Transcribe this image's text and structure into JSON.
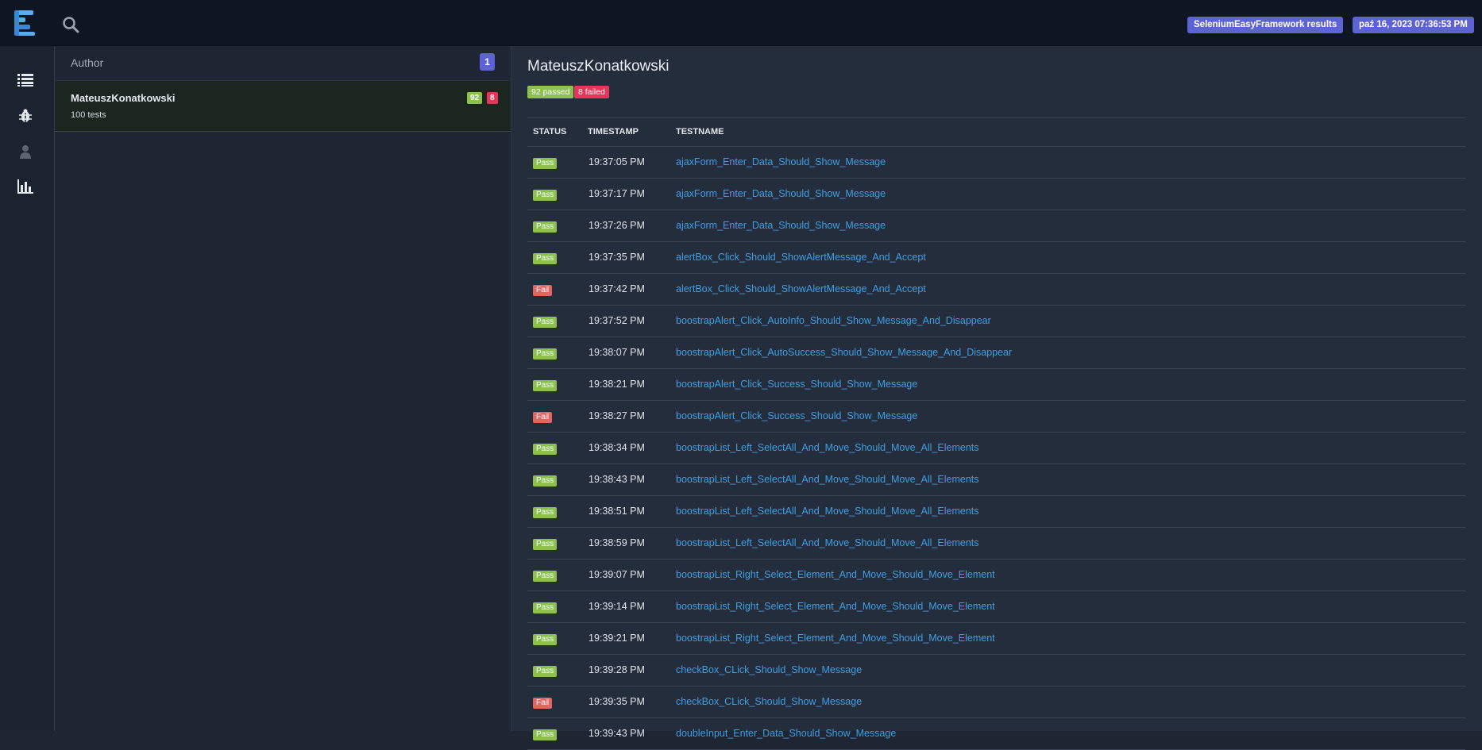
{
  "header": {
    "project_badge": "SeleniumEasyFramework results",
    "date_badge": "paź 16, 2023 07:36:53 PM",
    "logo_icon": "extent-logo-icon",
    "search_icon": "search-icon"
  },
  "nav": {
    "items": [
      {
        "icon": "list-icon"
      },
      {
        "icon": "bug-icon"
      },
      {
        "icon": "user-icon"
      },
      {
        "icon": "bar-chart-icon"
      }
    ]
  },
  "category": {
    "title": "Author",
    "count": "1",
    "items": [
      {
        "name": "MateuszKonatkowski",
        "sub": "100 tests",
        "passed": "92",
        "failed": "8"
      }
    ]
  },
  "detail": {
    "title": "MateuszKonatkowski",
    "passed_label": "92 passed",
    "failed_label": "8 failed",
    "columns": {
      "status": "STATUS",
      "timestamp": "TIMESTAMP",
      "testname": "TESTNAME"
    },
    "rows": [
      {
        "status": "Pass",
        "time": "19:37:05 PM",
        "name": "ajaxForm_Enter_Data_Should_Show_Message"
      },
      {
        "status": "Pass",
        "time": "19:37:17 PM",
        "name": "ajaxForm_Enter_Data_Should_Show_Message"
      },
      {
        "status": "Pass",
        "time": "19:37:26 PM",
        "name": "ajaxForm_Enter_Data_Should_Show_Message"
      },
      {
        "status": "Pass",
        "time": "19:37:35 PM",
        "name": "alertBox_Click_Should_ShowAlertMessage_And_Accept"
      },
      {
        "status": "Fail",
        "time": "19:37:42 PM",
        "name": "alertBox_Click_Should_ShowAlertMessage_And_Accept"
      },
      {
        "status": "Pass",
        "time": "19:37:52 PM",
        "name": "boostrapAlert_Click_AutoInfo_Should_Show_Message_And_Disappear"
      },
      {
        "status": "Pass",
        "time": "19:38:07 PM",
        "name": "boostrapAlert_Click_AutoSuccess_Should_Show_Message_And_Disappear"
      },
      {
        "status": "Pass",
        "time": "19:38:21 PM",
        "name": "boostrapAlert_Click_Success_Should_Show_Message"
      },
      {
        "status": "Fail",
        "time": "19:38:27 PM",
        "name": "boostrapAlert_Click_Success_Should_Show_Message"
      },
      {
        "status": "Pass",
        "time": "19:38:34 PM",
        "name": "boostrapList_Left_SelectAll_And_Move_Should_Move_All_Elements"
      },
      {
        "status": "Pass",
        "time": "19:38:43 PM",
        "name": "boostrapList_Left_SelectAll_And_Move_Should_Move_All_Elements"
      },
      {
        "status": "Pass",
        "time": "19:38:51 PM",
        "name": "boostrapList_Left_SelectAll_And_Move_Should_Move_All_Elements"
      },
      {
        "status": "Pass",
        "time": "19:38:59 PM",
        "name": "boostrapList_Left_SelectAll_And_Move_Should_Move_All_Elements"
      },
      {
        "status": "Pass",
        "time": "19:39:07 PM",
        "name": "boostrapList_Right_Select_Element_And_Move_Should_Move_Element"
      },
      {
        "status": "Pass",
        "time": "19:39:14 PM",
        "name": "boostrapList_Right_Select_Element_And_Move_Should_Move_Element"
      },
      {
        "status": "Pass",
        "time": "19:39:21 PM",
        "name": "boostrapList_Right_Select_Element_And_Move_Should_Move_Element"
      },
      {
        "status": "Pass",
        "time": "19:39:28 PM",
        "name": "checkBox_CLick_Should_Show_Message"
      },
      {
        "status": "Fail",
        "time": "19:39:35 PM",
        "name": "checkBox_CLick_Should_Show_Message"
      },
      {
        "status": "Pass",
        "time": "19:39:43 PM",
        "name": "doubleInput_Enter_Data_Should_Show_Message"
      }
    ]
  }
}
